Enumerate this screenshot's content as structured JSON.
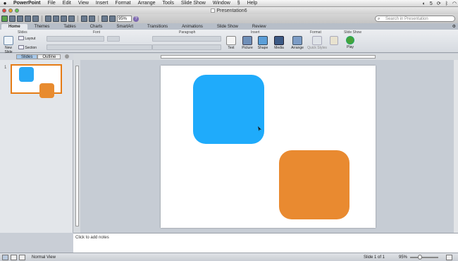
{
  "menubar": {
    "apple": "",
    "app_name": "PowerPoint",
    "items": [
      "File",
      "Edit",
      "View",
      "Insert",
      "Format",
      "Arrange",
      "Tools",
      "Slide Show",
      "Window",
      "Help"
    ],
    "script_icon": "script-menu-icon",
    "status": {
      "counter": "5",
      "clock": ""
    }
  },
  "window": {
    "title": "Presentation6"
  },
  "toolbar": {
    "zoom": "95%",
    "search_placeholder": "Search in Presentation"
  },
  "ribbon": {
    "tabs": [
      "Home",
      "Themes",
      "Tables",
      "Charts",
      "SmartArt",
      "Transitions",
      "Animations",
      "Slide Show",
      "Review"
    ],
    "active_tab": "Home",
    "groups": {
      "slides": "Slides",
      "font": "Font",
      "paragraph": "Paragraph",
      "insert": "Insert",
      "format": "Format",
      "slideshow": "Slide Show"
    },
    "buttons": {
      "new_slide": "New Slide",
      "layout": "Layout",
      "section": "Section",
      "text": "Text",
      "picture": "Picture",
      "shape": "Shape",
      "media": "Media",
      "arrange": "Arrange",
      "quick_styles": "Quick Styles",
      "play": "Play"
    }
  },
  "pane": {
    "tabs": [
      "Slides",
      "Outline"
    ],
    "active": "Slides",
    "slide_number": "1"
  },
  "slide": {
    "shapes": [
      {
        "name": "blue rounded rectangle",
        "color": "#1fabfb"
      },
      {
        "name": "orange rounded rectangle",
        "color": "#e98a30"
      }
    ]
  },
  "notes": {
    "placeholder": "Click to add notes"
  },
  "status": {
    "view": "Normal View",
    "slide": "Slide 1 of 1",
    "zoom": "95%"
  },
  "colors": {
    "accent_orange": "#e57c16",
    "blue_shape": "#1fabfb",
    "orange_shape": "#e98a30"
  }
}
